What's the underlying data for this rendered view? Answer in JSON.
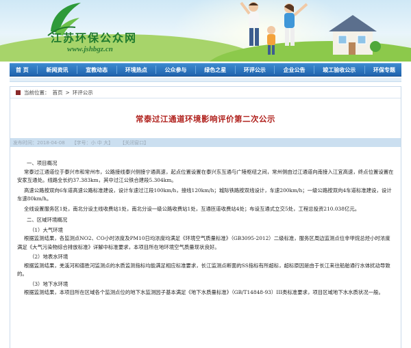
{
  "site": {
    "name": "江苏环保公众网",
    "url": "www.jshbgz.cn",
    "colors": {
      "brand_green": "#1f7a2e",
      "nav_blue": "#2a6fb8",
      "title_red": "#b0211d"
    }
  },
  "nav": {
    "items": [
      {
        "label": "首 页"
      },
      {
        "label": "新闻资讯"
      },
      {
        "label": "宣教动态"
      },
      {
        "label": "环境热点"
      },
      {
        "label": "公众参与"
      },
      {
        "label": "绿色之星"
      },
      {
        "label": "环评公示"
      },
      {
        "label": "企业公告"
      },
      {
        "label": "竣工验收公示"
      },
      {
        "label": "环保专题"
      }
    ]
  },
  "breadcrumb": {
    "prefix": "当前位置：",
    "home": "首页",
    "sep": ">",
    "current": "环评公示"
  },
  "article": {
    "title": "常泰过江通道环境影响评价第二次公示",
    "meta": {
      "date": "发布时间：2018-04-08",
      "font_size": "【字号：小 中 大】",
      "close": "【关闭窗口】"
    },
    "body": [
      {
        "type": "sec",
        "text": "一、项目概况"
      },
      {
        "type": "para",
        "text": "常泰过江通道位于泰兴市和常州市，公路接线泰兴侧接宁通高速，起点位置设置在泰兴东互通与广陵枢纽之间，常州侧由过江通道向南接入江宜高速，终点位置设置在安家互通处。线路全长约37.383km，其中过江公铁合建段5.304km。"
      },
      {
        "type": "para",
        "text": "高速公路按双向6车道高速公路标准建设，设计车速过江段100km/h，接线120km/h；城际铁路按双线设计，车速200km/h；一级公路按双向4车道标准建设，设计车速80km/h。"
      },
      {
        "type": "para",
        "text": "全线设置服务区1处，南北分设主线收费站1处，南北分设一级公路收费站1处，互通匝道收费站4处；布设互通式立交5处，工程总投资210.038亿元。"
      },
      {
        "type": "sec",
        "text": "二、区域环境概况"
      },
      {
        "type": "sub",
        "text": "（1）大气环境"
      },
      {
        "type": "para",
        "text": "根据监测结果，各监测点NO2、CO小时浓度及PM10日均浓度均满足《环境空气质量标准》（GB3095-2012）二级标准，服务区周边监测点位非甲烷总烃小时浓度满足《大气污染物综合排放标准》详解中标准要求，本项目所在地环境空气质量现状良好。"
      },
      {
        "type": "sub",
        "text": "（2）地表水环境"
      },
      {
        "type": "para",
        "text": "根据监测结果，羌溪河和德胜河监测点的水质监测指标均能满足相应标准要求，长江监测点断面的SS指标有所超标，超标原因是由于长江来往船舶通行水体扰动导致的。"
      },
      {
        "type": "sub",
        "text": "（3）地下水环境"
      },
      {
        "type": "para",
        "text": "根据监测结果，本项目所在区域各个监测点位的地下水监测因子基本满足《地下水质量标准》（GB/T14848-93）III类标准要求，项目区域地下水水质状况一般。"
      }
    ]
  }
}
